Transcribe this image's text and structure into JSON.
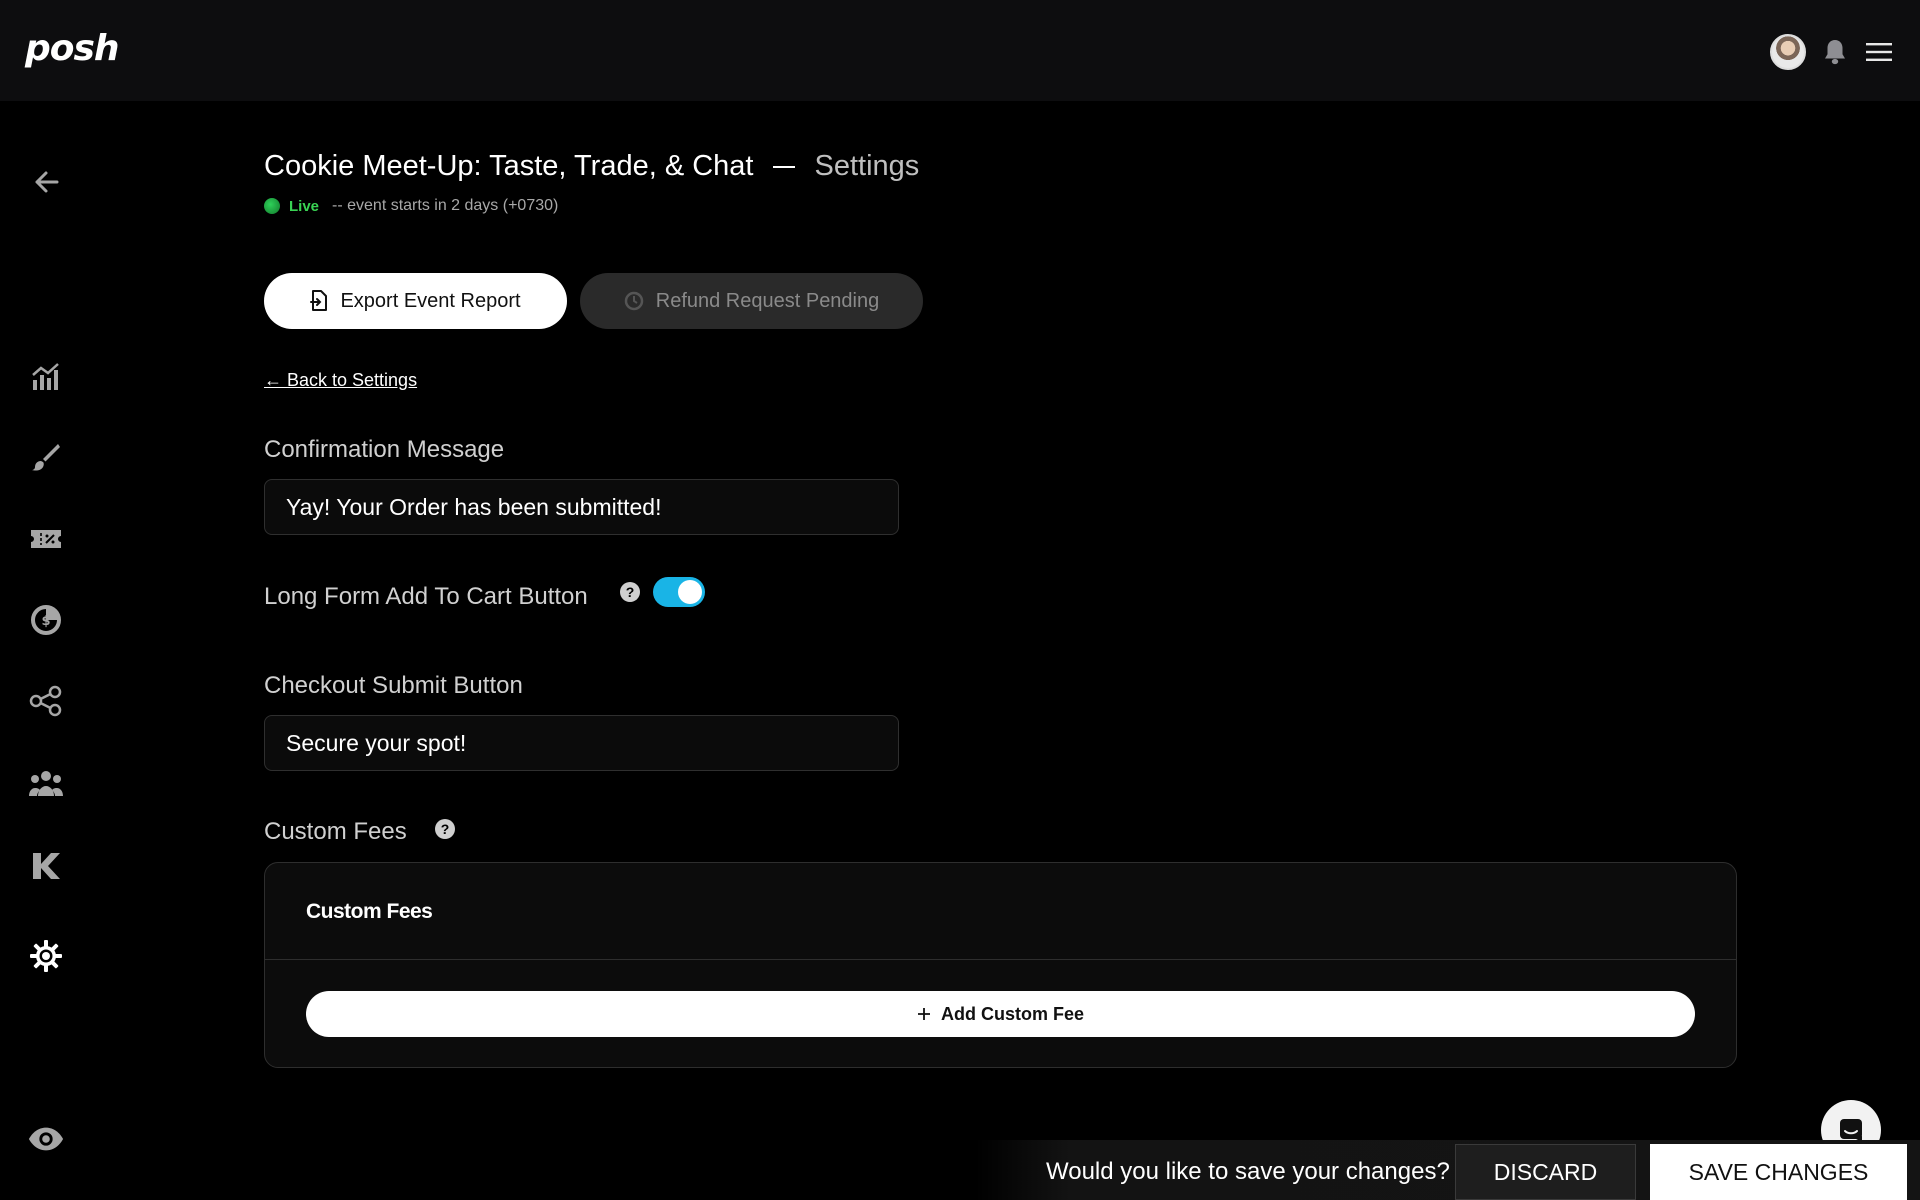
{
  "app": {
    "logo": "posh"
  },
  "header": {
    "event_name": "Cookie Meet-Up: Taste, Trade, & Chat",
    "breadcrumb": "Settings",
    "status_label": "Live",
    "status_text": "-- event starts in 2 days (+0730)"
  },
  "actions": {
    "export_label": "Export Event Report",
    "refund_label": "Refund Request Pending"
  },
  "back_link": "← Back to Settings",
  "form": {
    "confirmation_label": "Confirmation Message",
    "confirmation_value": "Yay! Your Order has been submitted!",
    "long_form_label": "Long Form Add To Cart Button",
    "long_form_enabled": true,
    "checkout_label": "Checkout Submit Button",
    "checkout_value": "Secure your spot!",
    "custom_fees_label": "Custom Fees",
    "help_glyph": "?"
  },
  "fees_card": {
    "title": "Custom Fees",
    "add_label": "Add Custom Fee"
  },
  "save_bar": {
    "question": "Would you like to save your changes?",
    "discard_label": "DISCARD",
    "save_label": "SAVE CHANGES"
  },
  "colors": {
    "accent_toggle": "#19b4e6",
    "live_green": "#39d353",
    "background": "#000000",
    "topbar": "#0d0d0f"
  },
  "icons": {
    "sidebar": [
      "back-arrow-icon",
      "analytics-icon",
      "paint-brush-icon",
      "ticket-icon",
      "finance-icon",
      "tracking-links-icon",
      "attendees-icon",
      "kickback-icon",
      "settings-gear-icon",
      "preview-eye-icon"
    ],
    "topbar": [
      "avatar",
      "bell-icon",
      "menu-icon"
    ]
  }
}
